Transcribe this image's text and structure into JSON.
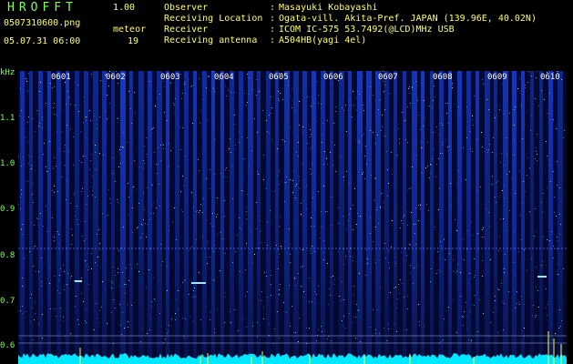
{
  "app": {
    "name": "HROFFT",
    "version": "1.00"
  },
  "file": {
    "name": "0507310600.png",
    "datetime": "05.07.31 06:00"
  },
  "meteor": {
    "label": "meteor",
    "count": "19"
  },
  "info": [
    {
      "label": "Observer",
      "value": "Masayuki Kobayashi"
    },
    {
      "label": "Receiving Location",
      "value": "Ogata-vill. Akita-Pref. JAPAN (139.96E, 40.02N)"
    },
    {
      "label": "Receiver",
      "value": "ICOM IC-575 53.7492(@LCD)MHz USB"
    },
    {
      "label": "Receiving antenna",
      "value": "A504HB(yagi 4el)"
    }
  ],
  "axis": {
    "unit": "kHz",
    "y_ticks": [
      "1.1",
      "1.0",
      "0.9",
      "0.8",
      "0.7",
      "0.6"
    ],
    "x_ticks": [
      "0601",
      "0602",
      "0603",
      "0604",
      "0605",
      "0606",
      "0607",
      "0608",
      "0609",
      "0610"
    ]
  },
  "colors": {
    "background": "#000000",
    "spectrum": "#1030a0",
    "text_green": "#7fff5a",
    "text_yellow": "#ffff66",
    "signal": "#00ffff"
  }
}
